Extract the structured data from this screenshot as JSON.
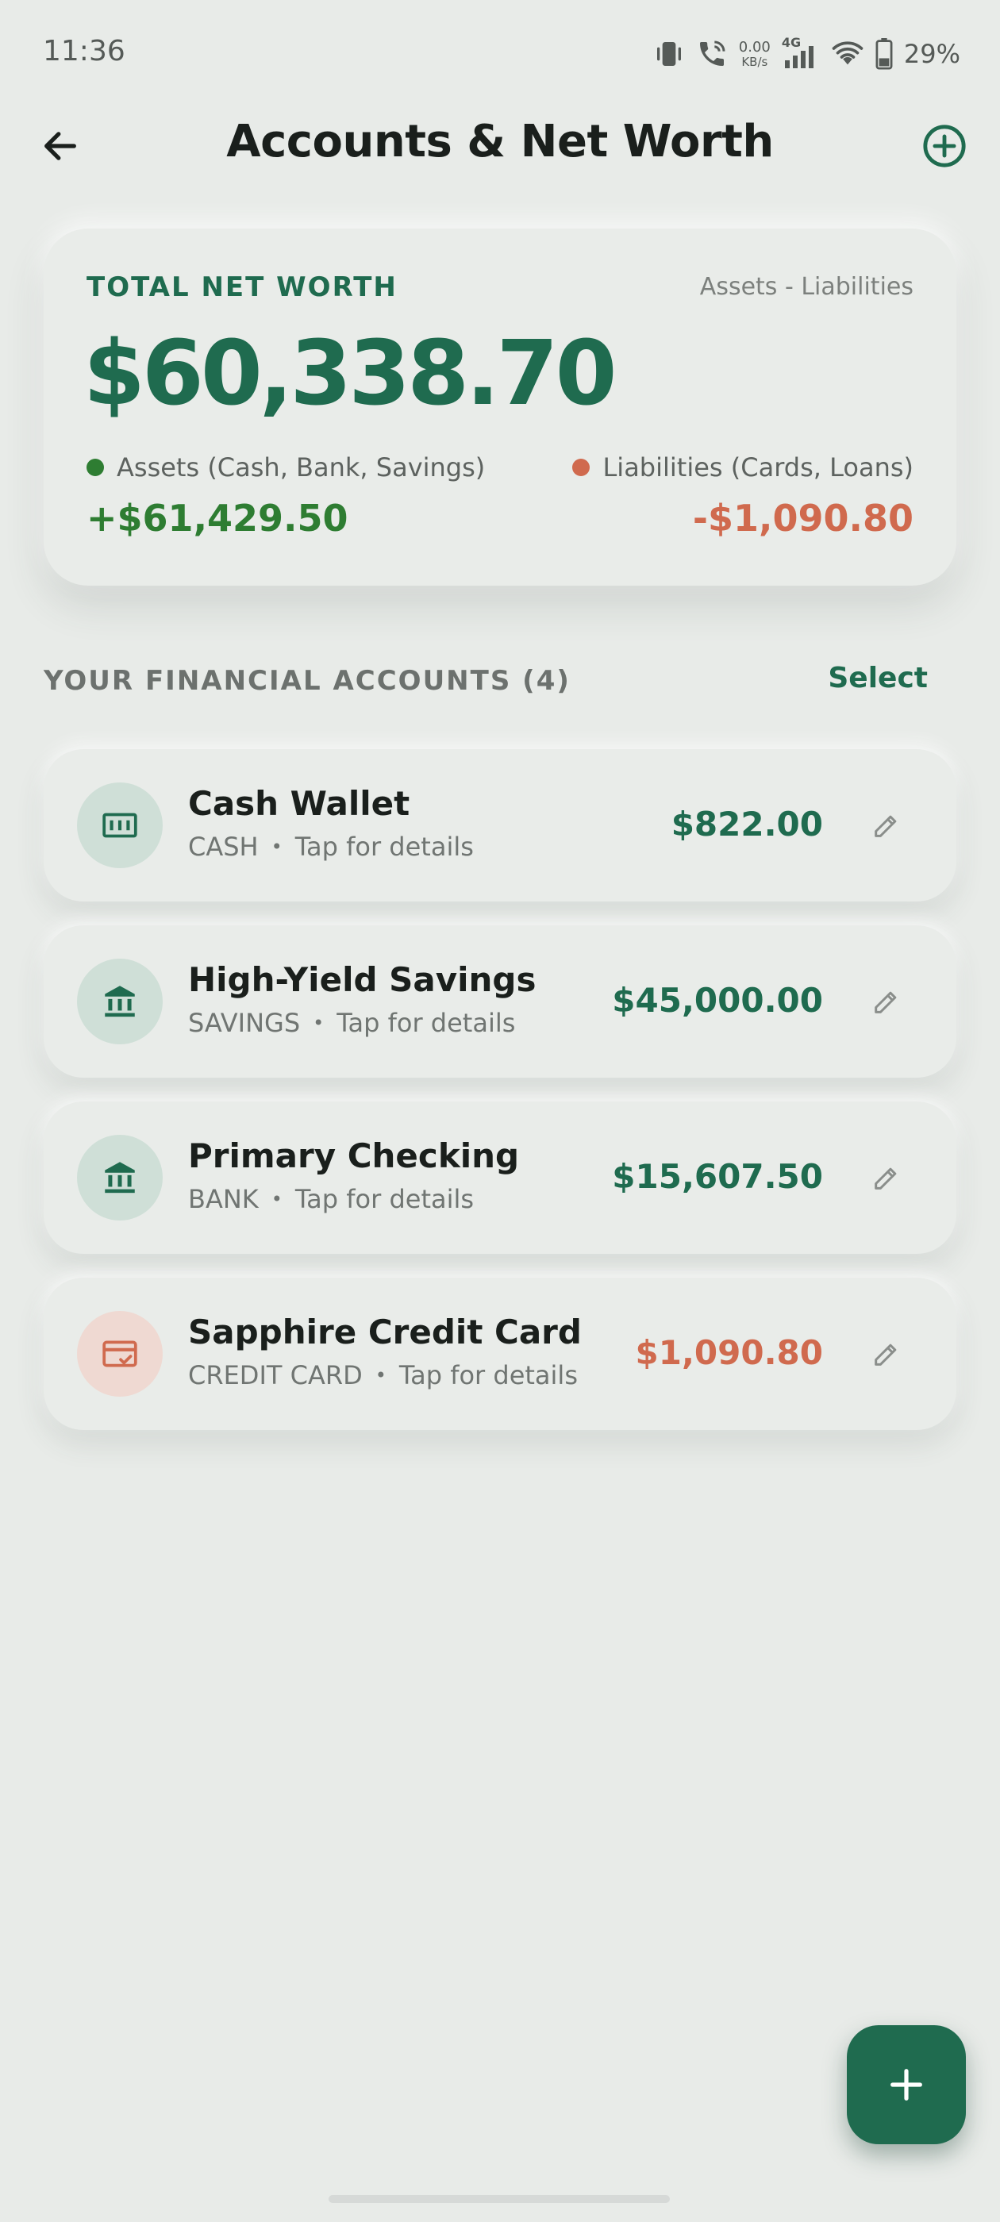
{
  "status_bar": {
    "time": "11:36",
    "net_speed_value": "0.00",
    "net_speed_unit": "KB/s",
    "network_type": "4G",
    "battery_percent": "29%"
  },
  "header": {
    "title": "Accounts & Net Worth",
    "back_icon": "arrow-left-icon",
    "add_icon": "plus-circle-icon"
  },
  "net_worth": {
    "label": "TOTAL NET WORTH",
    "formula": "Assets - Liabilities",
    "value": "$60,338.70",
    "assets_label": "Assets (Cash, Bank, Savings)",
    "assets_value": "+$61,429.50",
    "liabilities_label": "Liabilities (Cards, Loans)",
    "liabilities_value": "-$1,090.80"
  },
  "accounts_section": {
    "title": "YOUR FINANCIAL ACCOUNTS (4)",
    "select_label": "Select"
  },
  "accounts": [
    {
      "name": "Cash Wallet",
      "type": "CASH",
      "hint": "Tap for details",
      "balance": "$822.00",
      "icon": "cash-icon",
      "kind": "asset"
    },
    {
      "name": "High-Yield Savings",
      "type": "SAVINGS",
      "hint": "Tap for details",
      "balance": "$45,000.00",
      "icon": "bank-icon",
      "kind": "asset"
    },
    {
      "name": "Primary Checking",
      "type": "BANK",
      "hint": "Tap for details",
      "balance": "$15,607.50",
      "icon": "bank-icon",
      "kind": "asset"
    },
    {
      "name": "Sapphire Credit Card",
      "type": "CREDIT CARD",
      "hint": "Tap for details",
      "balance": "$1,090.80",
      "icon": "credit-card-icon",
      "kind": "liability"
    }
  ],
  "separator": "•",
  "colors": {
    "primary": "#1f6b4f",
    "asset_green": "#2e7d32",
    "liability_red": "#d06a4e",
    "background": "#e8ebe8"
  },
  "fab": {
    "icon": "plus-icon"
  }
}
